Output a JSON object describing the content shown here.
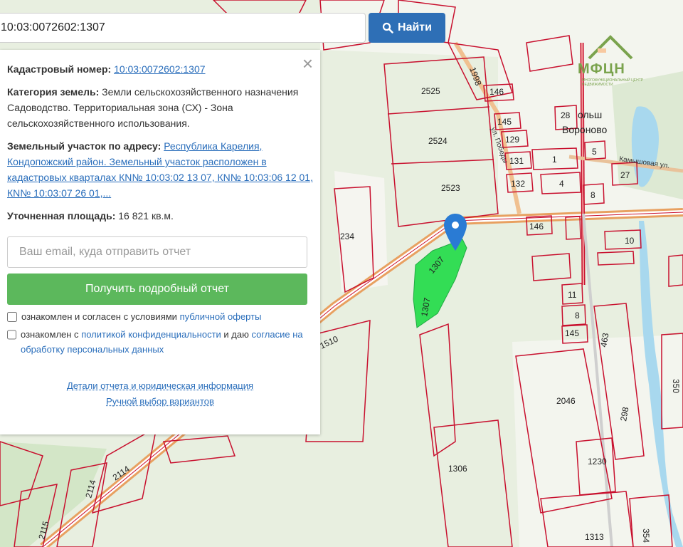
{
  "search": {
    "value": "10:03:0072602:1307",
    "button_label": "Найти"
  },
  "panel": {
    "cadastral_label": "Кадастровый номер:",
    "cadastral_value": "10:03:0072602:1307",
    "category_label": "Категория земель:",
    "category_value": "Земли сельскохозяйственного назначения",
    "use_text": "Садоводство. Территориальная зона (СХ) - Зона сельскохозяйственного использования.",
    "address_label": "Земельный участок по адресу:",
    "address_value": "Республика Карелия, Кондопожский район. Земельный участок расположен в кадастровых кварталах КN№ 10:03:02 13 07, КN№ 10:03:06 12 01, КN№ 10:03:07 26 01,...",
    "area_label": "Уточненная площадь:",
    "area_value": "16 821 кв.м.",
    "email_placeholder": "Ваш email, куда отправить отчет",
    "report_button": "Получить подробный отчет",
    "consent1_prefix": "ознакомлен и согласен с условиями ",
    "consent1_link": "публичной оферты",
    "consent2_prefix": "ознакомлен с ",
    "consent2_link1": "политикой конфиденциальности",
    "consent2_middle": " и даю ",
    "consent2_link2": "согласие на обработку персональных данных",
    "details_link": "Детали отчета и юридическая информация",
    "manual_link": "Ручной выбор вариантов",
    "close_symbol": "×"
  },
  "logo": {
    "text": "МФЦН",
    "subtitle": "Многофункциональный центр недвижимости",
    "color": "#7aa34d"
  },
  "map": {
    "plot_labels": [
      "1998",
      "2525",
      "2524",
      "2523",
      "234",
      "1307",
      "1307",
      "1510",
      "146",
      "145",
      "129",
      "131",
      "132",
      "1",
      "4",
      "8",
      "5",
      "27",
      "28",
      "146",
      "10",
      "11",
      "8",
      "145",
      "463",
      "298",
      "2046",
      "350",
      "1230",
      "1306",
      "1313",
      "354",
      "2114",
      "2114",
      "2115"
    ],
    "street_labels": [
      "ул. Победы",
      "Камышовая ул."
    ],
    "village_label": [
      "ольш",
      "Вороново"
    ],
    "colors": {
      "plot_border": "#c8102e",
      "selected_plot": "#33dd55",
      "road": "#e8a060",
      "water": "#a8d8ee",
      "forest": "#cfe3c0",
      "field": "#f4f6ef"
    }
  }
}
